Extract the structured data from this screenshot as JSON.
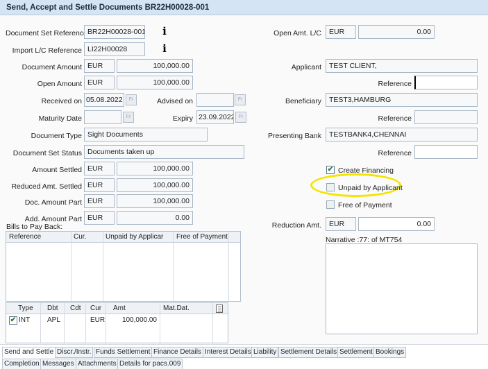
{
  "title": "Send, Accept and Settle Documents BR22H00028-001",
  "left": {
    "doc_set_ref_label": "Document Set Reference",
    "doc_set_ref": "BR22H00028-001",
    "import_lc_ref_label": "Import L/C Reference",
    "import_lc_ref": "LI22H00028",
    "doc_amount_label": "Document Amount",
    "doc_amount_cur": "EUR",
    "doc_amount": "100,000.00",
    "open_amount_label": "Open Amount",
    "open_amount_cur": "EUR",
    "open_amount": "100,000.00",
    "received_on_label": "Received on",
    "received_on": "05.08.2022",
    "advised_on_label": "Advised on",
    "advised_on": "",
    "maturity_date_label": "Maturity Date",
    "maturity_date": "",
    "expiry_label": "Expiry",
    "expiry": "23.09.2022",
    "doc_type_label": "Document Type",
    "doc_type": "Sight Documents",
    "doc_set_status_label": "Document Set Status",
    "doc_set_status": "Documents taken up",
    "amount_settled_label": "Amount Settled",
    "amount_settled_cur": "EUR",
    "amount_settled": "100,000.00",
    "reduced_amt_label": "Reduced Amt. Settled",
    "reduced_amt_cur": "EUR",
    "reduced_amt": "100,000.00",
    "doc_amount_part_label": "Doc. Amount Part",
    "doc_amount_part_cur": "EUR",
    "doc_amount_part": "100,000.00",
    "add_amount_part_label": "Add. Amount Part",
    "add_amount_part_cur": "EUR",
    "add_amount_part": "0.00",
    "bills_label": "Bills to Pay Back:",
    "cal_glyph": "Fr"
  },
  "bills_table": {
    "headers": [
      "Reference",
      "Cur.",
      "Unpaid by Applicar",
      "Free of Payment"
    ]
  },
  "items_table": {
    "headers": [
      "Type",
      "Dbt",
      "Cdt",
      "Cur",
      "Amt",
      "Mat.Dat."
    ],
    "rows": [
      {
        "checked": true,
        "type": "INT",
        "dbt": "APL",
        "cdt": "",
        "cur": "EUR",
        "amt": "100,000.00",
        "mat_dat": ""
      }
    ]
  },
  "right": {
    "open_amt_lc_label": "Open Amt. L/C",
    "open_amt_lc_cur": "EUR",
    "open_amt_lc": "0.00",
    "applicant_label": "Applicant",
    "applicant": "TEST CLIENT,",
    "reference_label": "Reference",
    "applicant_reference": "",
    "beneficiary_label": "Beneficiary",
    "beneficiary": "TEST3,HAMBURG",
    "beneficiary_reference": "",
    "presenting_bank_label": "Presenting Bank",
    "presenting_bank": "TESTBANK4,CHENNAI",
    "presenting_bank_reference": "",
    "create_financing_label": "Create Financing",
    "create_financing_checked": true,
    "unpaid_by_applicant_label": "Unpaid by Applicant",
    "unpaid_by_applicant_checked": false,
    "free_of_payment_label": "Free of Payment",
    "free_of_payment_checked": false,
    "reduction_amt_label": "Reduction Amt.",
    "reduction_amt_cur": "EUR",
    "reduction_amt": "0.00",
    "narrative_label": "Narrative :77: of MT754",
    "highlight_color": "#f2e500"
  },
  "tabs_row1": [
    "Send and Settle",
    "Discr./Instr.",
    "Funds Settlement",
    "Finance Details",
    "Interest Details",
    "Liability",
    "Settlement Details",
    "Settlement",
    "Bookings"
  ],
  "tabs_row2": [
    "Completion",
    "Messages",
    "Attachments",
    "Details for pacs.009"
  ],
  "active_tab": "Send and Settle"
}
